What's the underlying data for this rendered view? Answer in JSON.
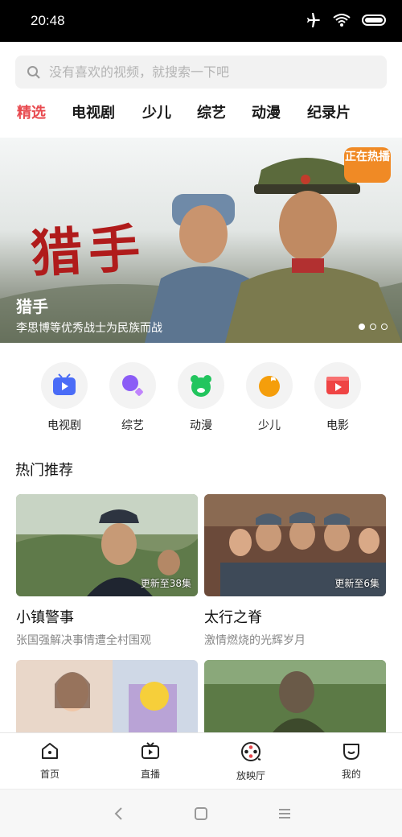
{
  "status": {
    "time": "20:48",
    "icons": [
      "airplane-icon",
      "wifi-icon",
      "battery-icon"
    ]
  },
  "search": {
    "placeholder": "没有喜欢的视频，就搜索一下吧"
  },
  "tabs": [
    {
      "label": "精选",
      "active": true
    },
    {
      "label": "电视剧"
    },
    {
      "label": "少儿"
    },
    {
      "label": "综艺"
    },
    {
      "label": "动漫"
    },
    {
      "label": "纪录片"
    }
  ],
  "banner": {
    "calligraphy": "猎手",
    "badge": "正在热播",
    "title": "猎手",
    "subtitle": "李思博等优秀战士为民族而战",
    "dots_total": 3,
    "dots_active": 1
  },
  "categories": [
    {
      "label": "电视剧",
      "icon": "tv-icon",
      "color": "#4a6cf7"
    },
    {
      "label": "综艺",
      "icon": "variety-icon",
      "color": "#8b5cf6"
    },
    {
      "label": "动漫",
      "icon": "anime-icon",
      "color": "#22c55e"
    },
    {
      "label": "少儿",
      "icon": "kids-icon",
      "color": "#f59e0b"
    },
    {
      "label": "电影",
      "icon": "movie-icon",
      "color": "#ef4444"
    }
  ],
  "section": {
    "title": "热门推荐"
  },
  "cards": [
    {
      "title": "小镇警事",
      "subtitle": "张国强解决事情遭全村围观",
      "update": "更新至38集"
    },
    {
      "title": "太行之脊",
      "subtitle": "激情燃烧的光辉岁月",
      "update": "更新至6集"
    },
    {
      "title": "",
      "subtitle": "",
      "update": ""
    },
    {
      "title": "",
      "subtitle": "",
      "update": ""
    }
  ],
  "tabbar": [
    {
      "label": "首页",
      "icon": "home-icon"
    },
    {
      "label": "直播",
      "icon": "live-tv-icon"
    },
    {
      "label": "放映厅",
      "icon": "film-reel-icon"
    },
    {
      "label": "我的",
      "icon": "profile-icon"
    }
  ],
  "accent": "#e84a4f"
}
